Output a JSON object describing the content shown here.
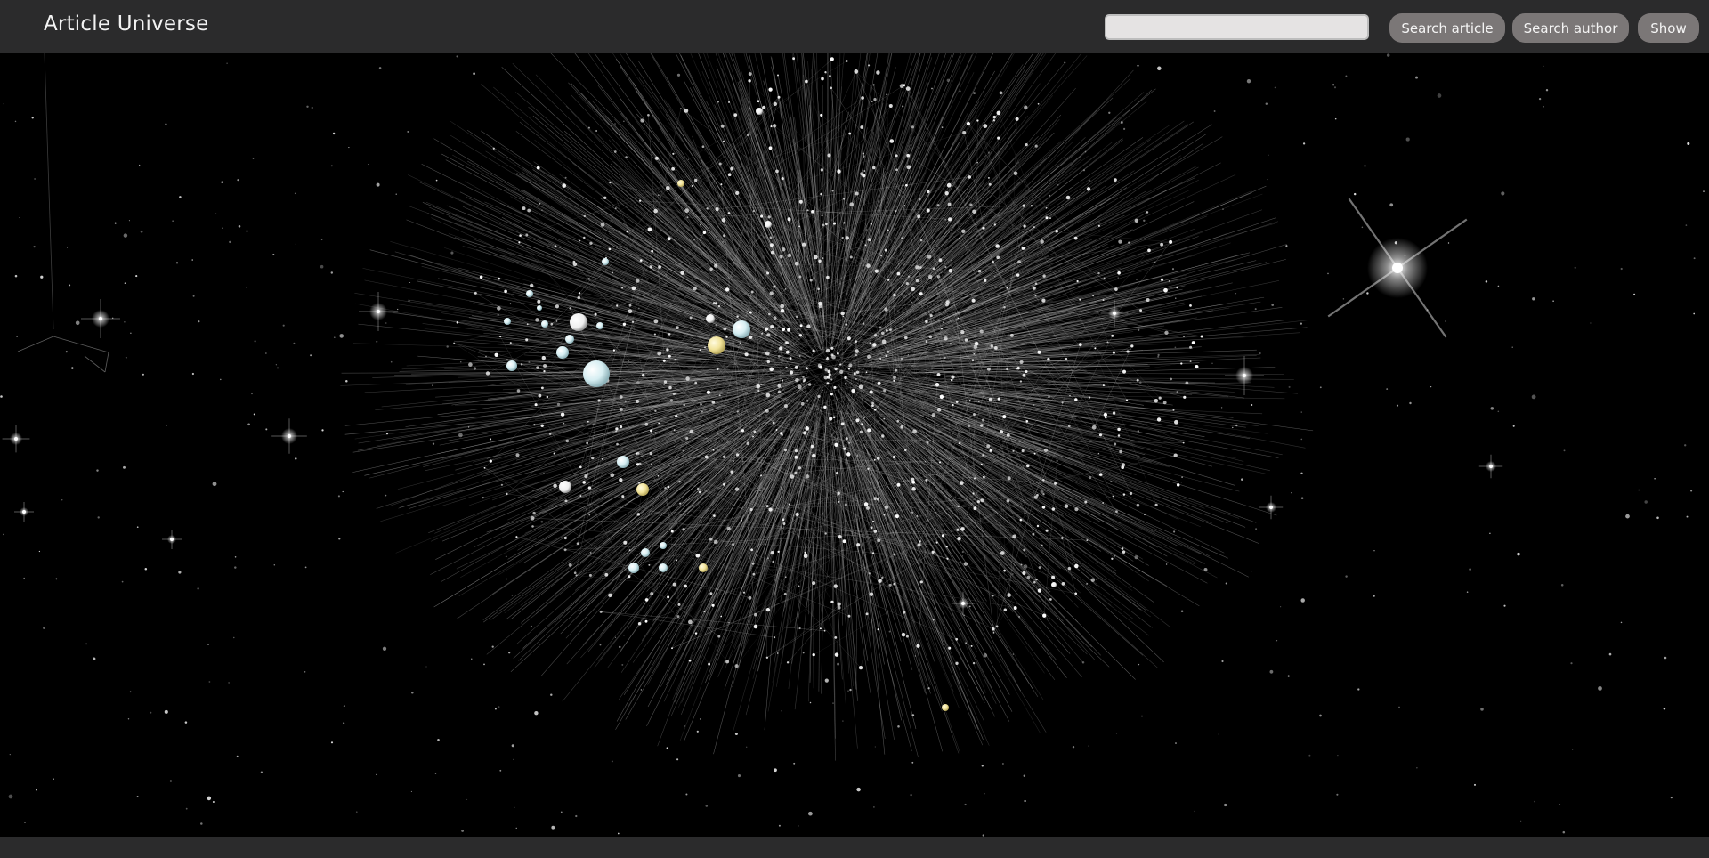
{
  "header": {
    "title": "Article Universe",
    "search": {
      "value": "",
      "placeholder": ""
    },
    "buttons": {
      "search_article": "Search article",
      "search_author": "Search author",
      "show": "Show"
    }
  },
  "graph_view": {
    "background": "#000000",
    "edge_color": "#bfbfbf",
    "node_colors": [
      "#e6f4f6",
      "#ffffff",
      "#f3e9a8",
      "#cfe8ee"
    ]
  }
}
